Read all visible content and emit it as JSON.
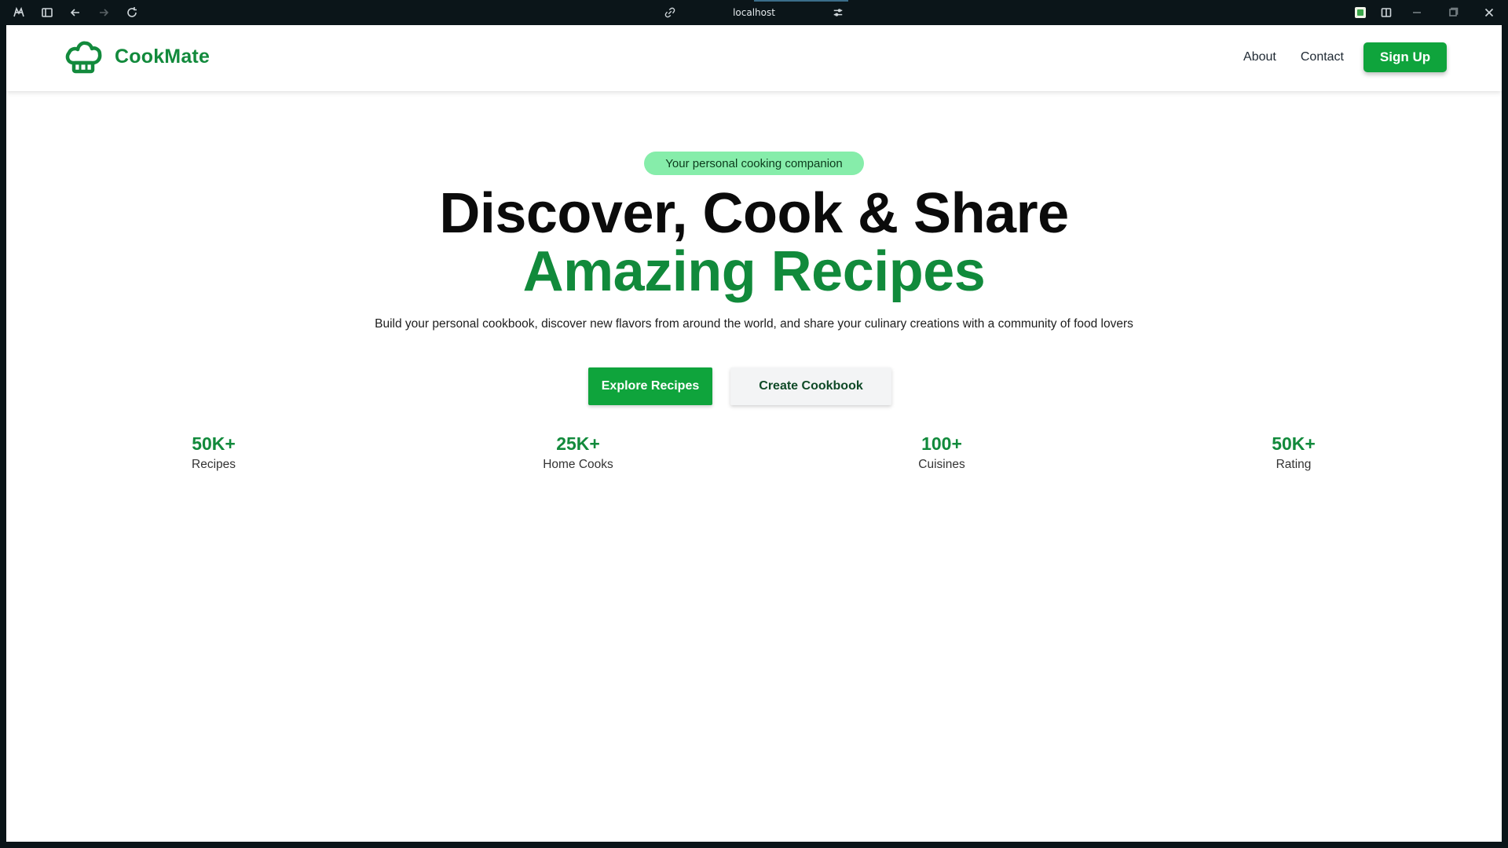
{
  "browser": {
    "url": "localhost",
    "icons": {
      "app": "app-logo-icon",
      "sidebar": "sidebar-toggle-icon",
      "back": "back-arrow-icon",
      "forward": "forward-arrow-icon",
      "reload": "reload-icon",
      "link": "link-icon",
      "settings": "tune-icon",
      "extension": "extension-icon",
      "split": "split-view-icon",
      "minimize": "minimize-icon",
      "maximize": "maximize-icon",
      "close": "close-icon"
    }
  },
  "navbar": {
    "brand": "CookMate",
    "brand_icon": "chef-hat-icon",
    "links": [
      "About",
      "Contact"
    ],
    "signup_label": "Sign Up"
  },
  "hero": {
    "pill": "Your personal cooking companion",
    "headline": "Discover, Cook & Share",
    "headline_accent": "Amazing Recipes",
    "subtitle": "Build your personal cookbook, discover new flavors from around the world, and share your culinary creations with a community of food lovers",
    "primary_cta": "Explore Recipes",
    "secondary_cta": "Create Cookbook"
  },
  "stats": [
    {
      "value": "50K+",
      "label": "Recipes"
    },
    {
      "value": "25K+",
      "label": "Home Cooks"
    },
    {
      "value": "100+",
      "label": "Cuisines"
    },
    {
      "value": "50K+",
      "label": "Rating"
    }
  ],
  "colors": {
    "brand_green": "#128a3c",
    "button_green": "#0fa43c",
    "pill_bg": "#86edaa",
    "chrome_bg": "#0b1519"
  }
}
